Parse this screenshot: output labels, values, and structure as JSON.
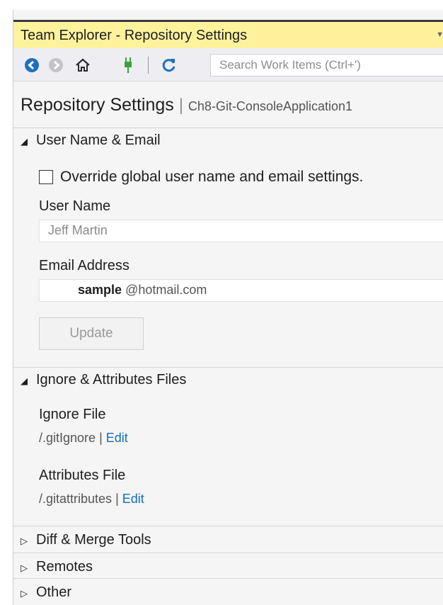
{
  "window": {
    "title": "Team Explorer - Repository Settings"
  },
  "toolbar": {
    "search_placeholder": "Search Work Items (Ctrl+')"
  },
  "header": {
    "title": "Repository Settings",
    "separator": "|",
    "repo_name": "Ch8-Git-ConsoleApplication1"
  },
  "sections": {
    "user": {
      "heading": "User Name & Email",
      "override_label": "Override global user name and email settings.",
      "override_checked": false,
      "user_name_label": "User Name",
      "user_name_value": "Jeff Martin",
      "email_label": "Email Address",
      "email_user": "sample",
      "email_domain": "@hotmail.com",
      "update_label": "Update"
    },
    "ignore": {
      "heading": "Ignore & Attributes Files",
      "ignore_label": "Ignore File",
      "ignore_path": "/.gitIgnore",
      "attributes_label": "Attributes File",
      "attributes_path": "/.gitattributes",
      "separator": "|",
      "edit_label": "Edit"
    },
    "diff": {
      "heading": "Diff & Merge Tools"
    },
    "remotes": {
      "heading": "Remotes"
    },
    "other": {
      "heading": "Other"
    }
  },
  "colors": {
    "title_bar": "#fff29d",
    "link": "#0e70c0",
    "nav_blue": "#1e6fbf",
    "plug_green": "#39a235"
  },
  "icons": [
    "back-icon",
    "forward-icon",
    "home-icon",
    "connect-icon",
    "refresh-icon"
  ]
}
